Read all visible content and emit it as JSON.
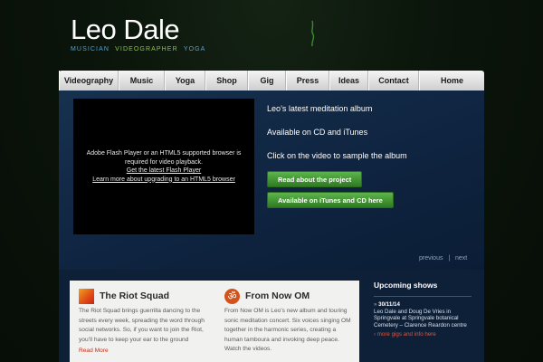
{
  "header": {
    "logo_name": "Leo Dale",
    "tagline_parts": [
      "MUSICIAN",
      "VIDEOGRAPHER",
      "YOGA"
    ]
  },
  "nav": {
    "items": [
      "Videography",
      "Music",
      "Yoga",
      "Shop",
      "Gig",
      "Press",
      "Ideas",
      "Contact",
      "Home"
    ]
  },
  "hero": {
    "video": {
      "message": "Adobe Flash Player or an HTML5 supported browser is required for video playback.",
      "link1": "Get the latest Flash Player",
      "link2": "Learn more about upgrading to an HTML5 browser"
    },
    "lines": [
      "Leo’s latest meditation album",
      "Available on CD and iTunes",
      "Click on the video to sample the album"
    ],
    "button_read": "Read about the project",
    "button_itunes": "Available on iTunes and CD here",
    "pager": {
      "previous": "previous",
      "separator": "|",
      "next": "next"
    }
  },
  "content": {
    "col1": {
      "title": "The Riot Squad",
      "body": "The Riot Squad brings guerrilla dancing to the streets every week, spreading the word through social networks. So, if you want to join the Riot, you’ll have to keep your ear to the ground",
      "read_more": "Read More"
    },
    "col2": {
      "title": "From Now OM",
      "body": "From Now OM is Leo’s new album and touring sonic meditation concert. Six voices singing OM together in the harmonic series, creating a human tamboura and invoking deep peace. Watch the videos."
    }
  },
  "shows": {
    "title": "Upcoming shows",
    "items": [
      {
        "date": "30/11/14",
        "text": "Leo Dale and Doug De Vries in Springvale at Springvale botanical Cemetery – Clarence Reardon centre"
      }
    ],
    "more_link": "more gigs and info here"
  },
  "colors": {
    "nav_bg": "#e0e0e0",
    "hero_bg": "#13294a",
    "button_green": "#4aa23a",
    "accent_red": "#c0311c"
  }
}
